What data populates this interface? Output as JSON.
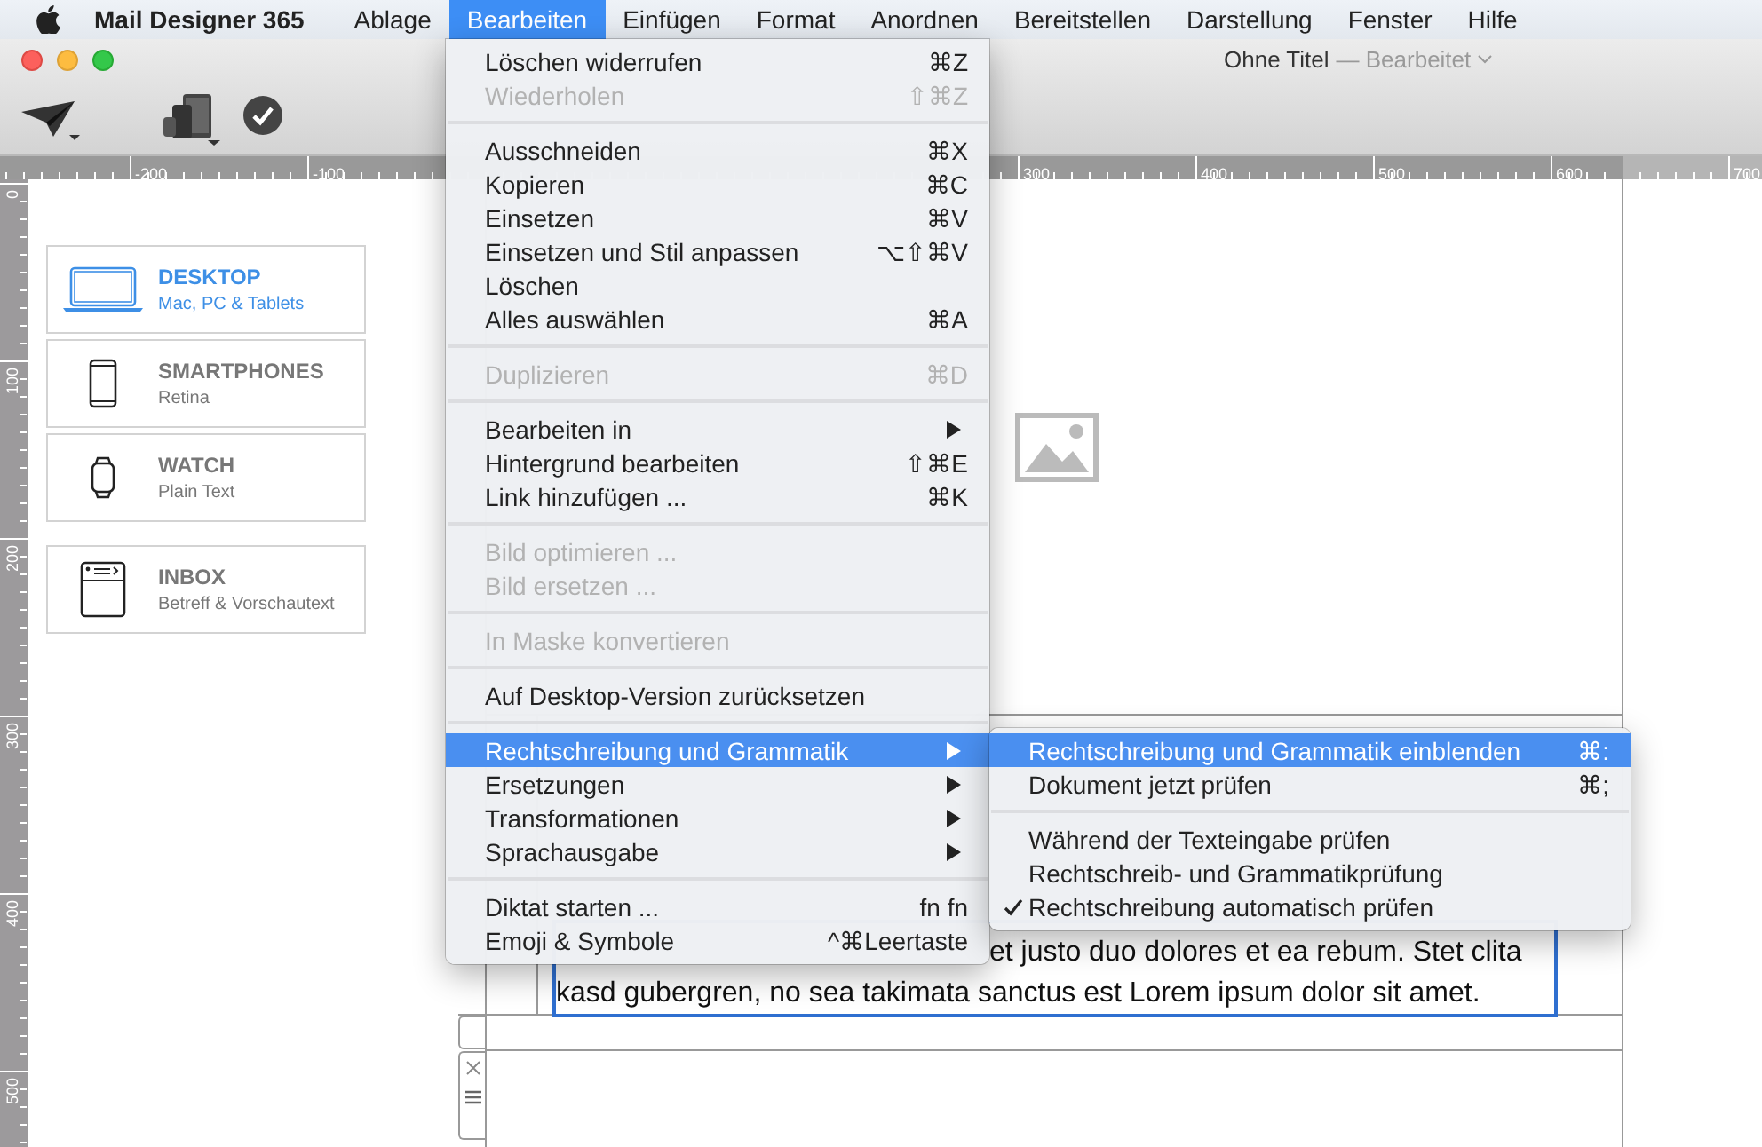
{
  "menubar": {
    "app_name": "Mail Designer 365",
    "items": [
      {
        "label": "Ablage",
        "selected": false
      },
      {
        "label": "Bearbeiten",
        "selected": true
      },
      {
        "label": "Einfügen",
        "selected": false
      },
      {
        "label": "Format",
        "selected": false
      },
      {
        "label": "Anordnen",
        "selected": false
      },
      {
        "label": "Bereitstellen",
        "selected": false
      },
      {
        "label": "Darstellung",
        "selected": false
      },
      {
        "label": "Fenster",
        "selected": false
      },
      {
        "label": "Hilfe",
        "selected": false
      }
    ]
  },
  "window": {
    "title": "Ohne Titel",
    "status": "— Bearbeitet"
  },
  "ruler": {
    "left_labels": [
      "-200",
      "-100"
    ],
    "right_labels": [
      "300",
      "400",
      "500",
      "600",
      "700"
    ],
    "vertical_labels": [
      "0",
      "100",
      "200",
      "300",
      "400",
      "500"
    ]
  },
  "devices": [
    {
      "kind": "desktop",
      "title": "DESKTOP",
      "subtitle": "Mac, PC & Tablets",
      "selected": true
    },
    {
      "kind": "phone",
      "title": "SMARTPHONES",
      "subtitle": "Retina",
      "selected": false
    },
    {
      "kind": "watch",
      "title": "WATCH",
      "subtitle": "Plain Text",
      "selected": false
    }
  ],
  "preview": [
    {
      "kind": "inbox",
      "title": "INBOX",
      "subtitle": "Betreff & Vorschautext",
      "selected": false
    }
  ],
  "text_block": {
    "lines": [
      "et justo duo dolores et ea rebum. Stet clita",
      "kasd gubergren, no sea takimata sanctus est Lorem ipsum dolor sit amet."
    ]
  },
  "menu": {
    "items": [
      {
        "kind": "item",
        "label": "Löschen widerrufen",
        "shortcut": "⌘Z",
        "disabled": false,
        "submenu": false,
        "selected": false
      },
      {
        "kind": "item",
        "label": "Wiederholen",
        "shortcut": "⇧⌘Z",
        "disabled": true,
        "submenu": false,
        "selected": false
      },
      {
        "kind": "separator"
      },
      {
        "kind": "item",
        "label": "Ausschneiden",
        "shortcut": "⌘X",
        "disabled": false,
        "submenu": false,
        "selected": false
      },
      {
        "kind": "item",
        "label": "Kopieren",
        "shortcut": "⌘C",
        "disabled": false,
        "submenu": false,
        "selected": false
      },
      {
        "kind": "item",
        "label": "Einsetzen",
        "shortcut": "⌘V",
        "disabled": false,
        "submenu": false,
        "selected": false
      },
      {
        "kind": "item",
        "label": "Einsetzen und Stil anpassen",
        "shortcut": "⌥⇧⌘V",
        "disabled": false,
        "submenu": false,
        "selected": false
      },
      {
        "kind": "item",
        "label": "Löschen",
        "disabled": false,
        "submenu": false,
        "selected": false
      },
      {
        "kind": "item",
        "label": "Alles auswählen",
        "shortcut": "⌘A",
        "disabled": false,
        "submenu": false,
        "selected": false
      },
      {
        "kind": "separator"
      },
      {
        "kind": "item",
        "label": "Duplizieren",
        "shortcut": "⌘D",
        "disabled": true,
        "submenu": false,
        "selected": false
      },
      {
        "kind": "separator"
      },
      {
        "kind": "item",
        "label": "Bearbeiten in",
        "disabled": false,
        "submenu": true,
        "selected": false
      },
      {
        "kind": "item",
        "label": "Hintergrund bearbeiten",
        "shortcut": "⇧⌘E",
        "disabled": false,
        "submenu": false,
        "selected": false
      },
      {
        "kind": "item",
        "label": "Link hinzufügen ...",
        "shortcut": "⌘K",
        "disabled": false,
        "submenu": false,
        "selected": false
      },
      {
        "kind": "separator"
      },
      {
        "kind": "item",
        "label": "Bild optimieren ...",
        "disabled": true,
        "submenu": false,
        "selected": false
      },
      {
        "kind": "item",
        "label": "Bild ersetzen ...",
        "disabled": true,
        "submenu": false,
        "selected": false
      },
      {
        "kind": "separator"
      },
      {
        "kind": "item",
        "label": "In Maske konvertieren",
        "disabled": true,
        "submenu": false,
        "selected": false
      },
      {
        "kind": "separator"
      },
      {
        "kind": "item",
        "label": "Auf Desktop-Version zurücksetzen",
        "disabled": false,
        "submenu": false,
        "selected": false
      },
      {
        "kind": "separator"
      },
      {
        "kind": "item",
        "label": "Rechtschreibung und Grammatik",
        "disabled": false,
        "submenu": true,
        "selected": true
      },
      {
        "kind": "item",
        "label": "Ersetzungen",
        "disabled": false,
        "submenu": true,
        "selected": false
      },
      {
        "kind": "item",
        "label": "Transformationen",
        "disabled": false,
        "submenu": true,
        "selected": false
      },
      {
        "kind": "item",
        "label": "Sprachausgabe",
        "disabled": false,
        "submenu": true,
        "selected": false
      },
      {
        "kind": "separator"
      },
      {
        "kind": "item",
        "label": "Diktat starten ...",
        "shortcut": "fn fn",
        "disabled": false,
        "submenu": false,
        "selected": false
      },
      {
        "kind": "item",
        "label": "Emoji & Symbole",
        "shortcut": "^⌘Leertaste",
        "disabled": false,
        "submenu": false,
        "selected": false
      }
    ]
  },
  "submenu": {
    "items": [
      {
        "kind": "item",
        "label": "Rechtschreibung und Grammatik einblenden",
        "shortcut": "⌘:",
        "checked": false,
        "selected": true
      },
      {
        "kind": "item",
        "label": "Dokument jetzt prüfen",
        "shortcut": "⌘;",
        "checked": false,
        "selected": false
      },
      {
        "kind": "separator"
      },
      {
        "kind": "item",
        "label": "Während der Texteingabe prüfen",
        "checked": false,
        "selected": false
      },
      {
        "kind": "item",
        "label": "Rechtschreib- und Grammatikprüfung",
        "checked": false,
        "selected": false
      },
      {
        "kind": "item",
        "label": "Rechtschreibung automatisch prüfen",
        "checked": true,
        "selected": false
      }
    ]
  }
}
